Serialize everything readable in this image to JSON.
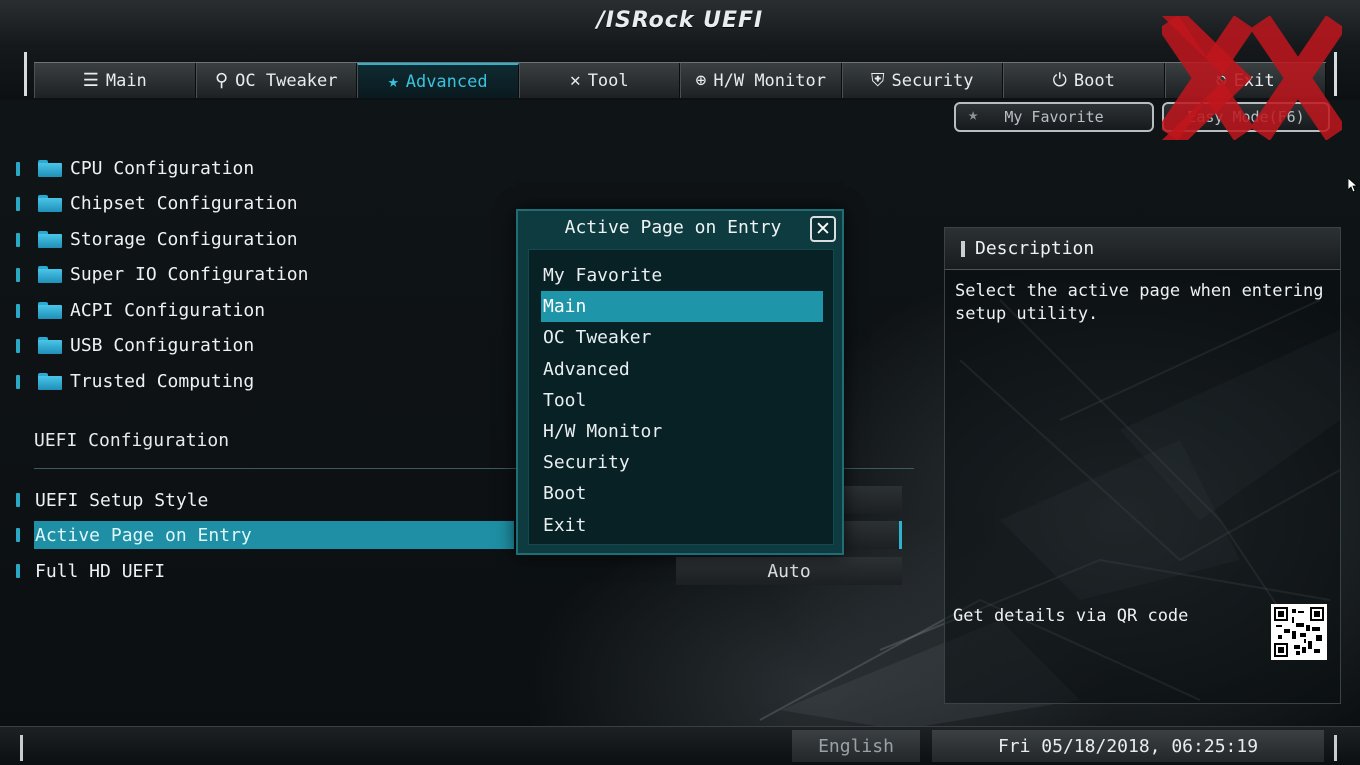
{
  "header": {
    "logo": "/ISRock UEFI",
    "tabs": [
      {
        "icon": "list-icon",
        "glyph": "☰",
        "label": "Main"
      },
      {
        "icon": "rocket-icon",
        "glyph": "⚲",
        "label": "OC Tweaker"
      },
      {
        "icon": "star-icon",
        "glyph": "★",
        "label": "Advanced",
        "active": true
      },
      {
        "icon": "tool-icon",
        "glyph": "✕",
        "label": "Tool"
      },
      {
        "icon": "crosshair-icon",
        "glyph": "⊕",
        "label": "H/W Monitor"
      },
      {
        "icon": "shield-icon",
        "glyph": "⛨",
        "label": "Security"
      },
      {
        "icon": "power-icon",
        "glyph": "⏻",
        "label": "Boot"
      },
      {
        "icon": "exit-icon",
        "glyph": "⎋",
        "label": "Exit"
      }
    ]
  },
  "toolbar": {
    "favorite_label": "My Favorite",
    "easy_mode_label": "Easy Mode(F6)"
  },
  "menu": {
    "items": [
      "CPU Configuration",
      "Chipset Configuration",
      "Storage Configuration",
      "Super IO Configuration",
      "ACPI Configuration",
      "USB Configuration",
      "Trusted Computing"
    ]
  },
  "uefi_config": {
    "title": "UEFI Configuration",
    "settings": [
      {
        "label": "UEFI Setup Style",
        "value": ""
      },
      {
        "label": "Active Page on Entry",
        "value": "",
        "selected": true
      },
      {
        "label": "Full HD UEFI",
        "value": "Auto"
      }
    ]
  },
  "description": {
    "title": "Description",
    "text": "Select the active page when entering setup utility.",
    "qr_label": "Get details via QR code"
  },
  "popup": {
    "title": "Active Page on Entry",
    "close_glyph": "✕",
    "options": [
      "My Favorite",
      "Main",
      "OC Tweaker",
      "Advanced",
      "Tool",
      "H/W Monitor",
      "Security",
      "Boot",
      "Exit"
    ],
    "selected": "Main"
  },
  "footer": {
    "language": "English",
    "datetime": "Fri 05/18/2018, 06:25:19"
  },
  "colors": {
    "accent": "#2fb3cc",
    "selection": "#1e8fa4",
    "popup_bg": "#0e3b40",
    "watermark": "#c0161d"
  }
}
